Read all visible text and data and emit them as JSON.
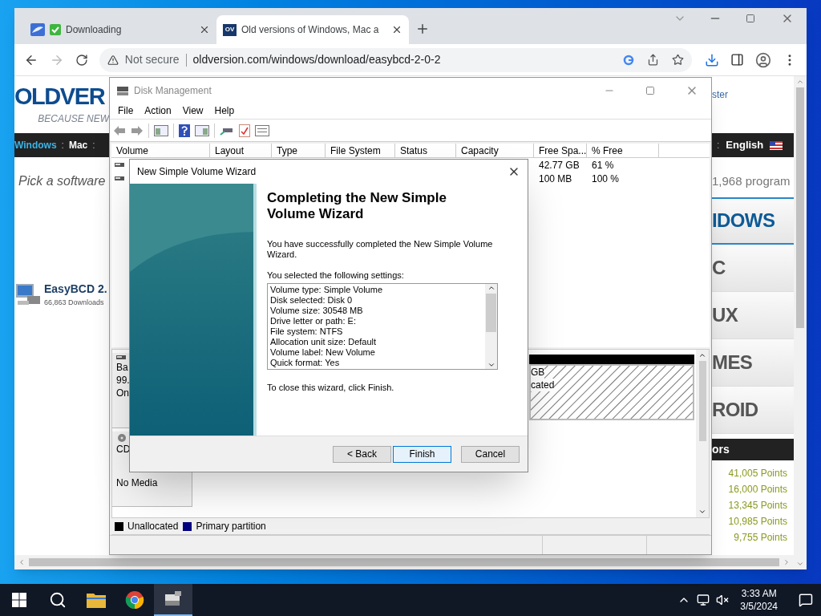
{
  "browser": {
    "tabs": [
      {
        "kind": "download",
        "title": "Downloading",
        "selected": false
      },
      {
        "kind": "site",
        "title": "Old versions of Windows, Mac a",
        "favicon": "OV",
        "selected": true
      }
    ],
    "back_disabled": false,
    "forward_disabled": true,
    "security": "Not secure",
    "url": "oldversion.com/windows/download/easybcd-2-0-2"
  },
  "website": {
    "logo": "OLDVER",
    "tagline": "BECAUSE NEW",
    "top_link": "ster",
    "nav_left": [
      {
        "kind": "link",
        "label": "Windows",
        "selected": true
      },
      {
        "kind": "separator",
        "label": ":"
      },
      {
        "kind": "link",
        "label": "Mac",
        "selected": false
      },
      {
        "kind": "separator",
        "label": ":"
      }
    ],
    "nav_right": [
      {
        "kind": "separator",
        "label": ":"
      },
      {
        "kind": "language",
        "label": "English"
      }
    ],
    "intro": "Pick a software",
    "count": "1,968 program",
    "software": {
      "name": "EasyBCD 2.",
      "downloads": "66,863 Downloads"
    },
    "categories": [
      {
        "label": "IDOWS",
        "selected": true
      },
      {
        "label": "C",
        "selected": false
      },
      {
        "label": "UX",
        "selected": false
      },
      {
        "label": "MES",
        "selected": false
      },
      {
        "label": "ROID",
        "selected": false
      }
    ],
    "contributors_title": "ors",
    "points": [
      "41,005 Points",
      "16,000 Points",
      "13,345 Points",
      "10,985 Points",
      "9,755 Points"
    ]
  },
  "disk_management": {
    "title": "Disk Management",
    "active": false,
    "menu": [
      "File",
      "Action",
      "View",
      "Help"
    ],
    "columns": [
      "Volume",
      "Layout",
      "Type",
      "File System",
      "Status",
      "Capacity",
      "Free Spa...",
      "% Free"
    ],
    "rows": [
      {
        "free_space": "42.77 GB",
        "percent_free": "61 %"
      },
      {
        "free_space": "100 MB",
        "percent_free": "100 %"
      }
    ],
    "disks": [
      {
        "kind": "basic",
        "lines": [
          "Ba",
          "99.",
          "On"
        ],
        "partition": {
          "lines": [
            "GB",
            "cated"
          ],
          "color": "#000000"
        }
      },
      {
        "kind": "cdrom",
        "lines": [
          "CD",
          "No Media"
        ]
      }
    ],
    "legend": [
      {
        "label": "Unallocated",
        "color": "#000000"
      },
      {
        "label": "Primary partition",
        "color": "#000080"
      }
    ]
  },
  "wizard": {
    "title": "New Simple Volume Wizard",
    "active": true,
    "heading": "Completing the New Simple Volume Wizard",
    "message": "You have successfully completed the New Simple Volume Wizard.",
    "settings_label": "You selected the following settings:",
    "settings": [
      "Volume type: Simple Volume",
      "Disk selected: Disk 0",
      "Volume size: 30548 MB",
      "Drive letter or path: E:",
      "File system: NTFS",
      "Allocation unit size: Default",
      "Volume label: New Volume",
      "Quick format: Yes"
    ],
    "closing": "To close this wizard, click Finish.",
    "buttons": [
      {
        "label": "< Back",
        "focused": false
      },
      {
        "label": "Finish",
        "focused": true
      },
      {
        "label": "Cancel",
        "focused": false
      }
    ]
  },
  "taskbar": {
    "apps": [
      {
        "kind": "start",
        "active": false
      },
      {
        "kind": "search",
        "active": false
      },
      {
        "kind": "explorer",
        "active": false
      },
      {
        "kind": "chrome",
        "active": false
      },
      {
        "kind": "disk",
        "active": true
      }
    ],
    "time": "3:33 AM",
    "date": "3/5/2024"
  }
}
